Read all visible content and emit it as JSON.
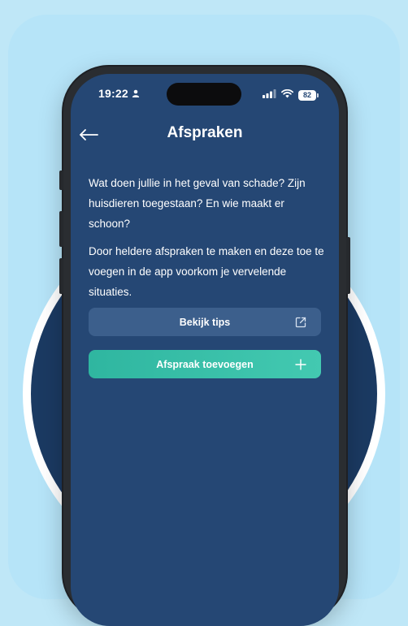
{
  "status_bar": {
    "time": "19:22",
    "battery": "82"
  },
  "header": {
    "title": "Afspraken"
  },
  "content": {
    "paragraph_1": "Wat doen jullie in het geval van schade? Zijn huisdieren toegestaan? En wie maakt er schoon?",
    "paragraph_2": "Door heldere afspraken te maken en deze toe te voegen in de app voorkom je vervelende situaties."
  },
  "actions": {
    "tips_label": "Bekijk tips",
    "tips_icon": "external-link-icon",
    "add_label": "Afspraak toevoegen",
    "add_icon": "plus-icon"
  },
  "colors": {
    "background": "#bfe7f7",
    "screen": "#254774",
    "circle": "#1b3a62",
    "tips_button": "#3c5f8c",
    "accent_teal": "#3cc0a8"
  }
}
